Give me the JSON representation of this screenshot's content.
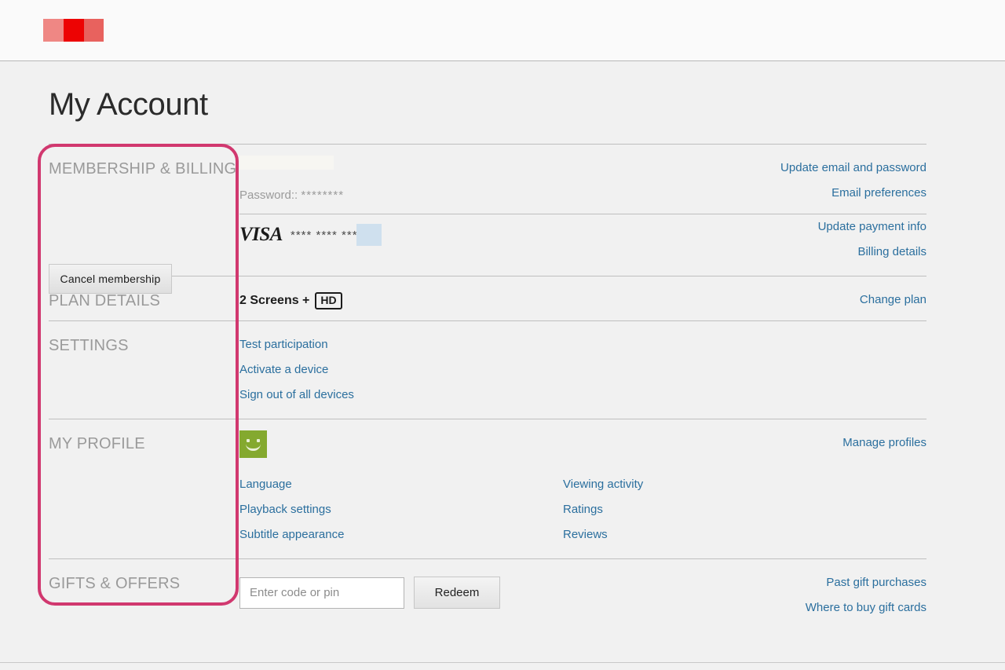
{
  "header": {
    "logo_name": "brand-logo-redacted",
    "logo_colors": [
      "#ef8784",
      "#ed0303",
      "#e8625e"
    ]
  },
  "page": {
    "title": "My Account"
  },
  "highlight": {
    "color": "#d1386f",
    "name": "left-column-highlight"
  },
  "sections": {
    "membership": {
      "label": "MEMBERSHIP & BILLING",
      "cancel_button": "Cancel membership",
      "password_label": "Password::",
      "password_value": "********",
      "card_brand": "VISA",
      "card_digits": "**** **** ****",
      "links_top": [
        "Update email and password",
        "Email preferences"
      ],
      "links_bottom": [
        "Update payment info",
        "Billing details"
      ]
    },
    "plan": {
      "label": "PLAN DETAILS",
      "plan_value": "2 Screens +",
      "plan_badge": "HD",
      "link": "Change plan"
    },
    "settings": {
      "label": "SETTINGS",
      "links": [
        "Test participation",
        "Activate a device",
        "Sign out of all devices"
      ]
    },
    "profile": {
      "label": "MY PROFILE",
      "avatar_name": "profile-avatar-green-smiley",
      "manage_link": "Manage profiles",
      "links_col1": [
        "Language",
        "Playback settings",
        "Subtitle appearance"
      ],
      "links_col2": [
        "Viewing activity",
        "Ratings",
        "Reviews"
      ]
    },
    "gifts": {
      "label": "GIFTS & OFFERS",
      "input_placeholder": "Enter code or pin",
      "input_value": "",
      "redeem_button": "Redeem",
      "links": [
        "Past gift purchases",
        "Where to buy gift cards"
      ]
    }
  }
}
